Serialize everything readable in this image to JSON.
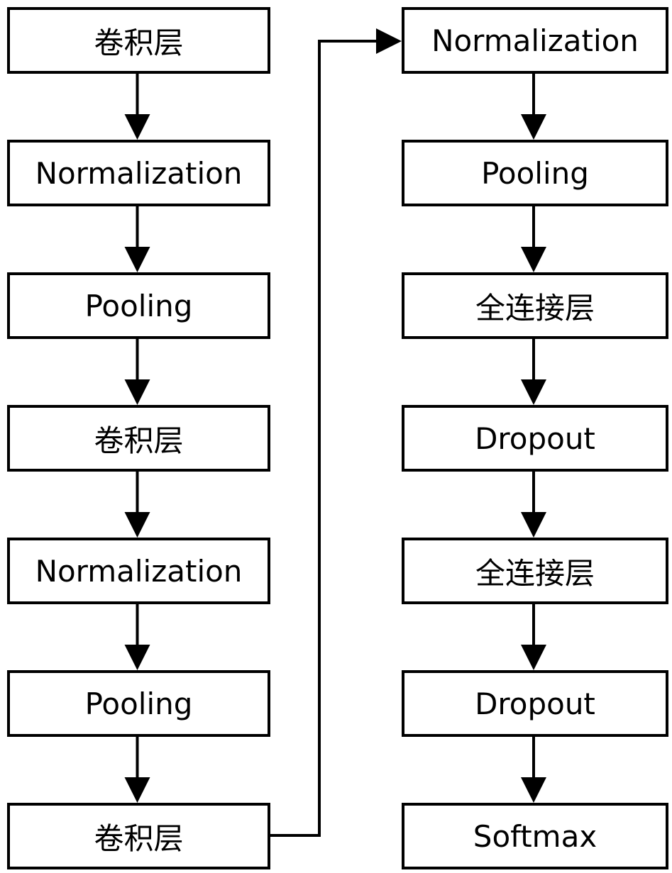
{
  "diagram": {
    "type": "flowchart",
    "stroke_color": "#000000",
    "background_color": "#ffffff",
    "left_column": [
      {
        "id": "L1",
        "label": "卷积层"
      },
      {
        "id": "L2",
        "label": "Normalization"
      },
      {
        "id": "L3",
        "label": "Pooling"
      },
      {
        "id": "L4",
        "label": "卷积层"
      },
      {
        "id": "L5",
        "label": "Normalization"
      },
      {
        "id": "L6",
        "label": "Pooling"
      },
      {
        "id": "L7",
        "label": "卷积层"
      }
    ],
    "right_column": [
      {
        "id": "R1",
        "label": "Normalization"
      },
      {
        "id": "R2",
        "label": "Pooling"
      },
      {
        "id": "R3",
        "label": "全连接层"
      },
      {
        "id": "R4",
        "label": "Dropout"
      },
      {
        "id": "R5",
        "label": "全连接层"
      },
      {
        "id": "R6",
        "label": "Dropout"
      },
      {
        "id": "R7",
        "label": "Softmax"
      }
    ],
    "edges": [
      [
        "L1",
        "L2"
      ],
      [
        "L2",
        "L3"
      ],
      [
        "L3",
        "L4"
      ],
      [
        "L4",
        "L5"
      ],
      [
        "L5",
        "L6"
      ],
      [
        "L6",
        "L7"
      ],
      [
        "L7",
        "R1"
      ],
      [
        "R1",
        "R2"
      ],
      [
        "R2",
        "R3"
      ],
      [
        "R3",
        "R4"
      ],
      [
        "R4",
        "R5"
      ],
      [
        "R5",
        "R6"
      ],
      [
        "R6",
        "R7"
      ]
    ]
  }
}
